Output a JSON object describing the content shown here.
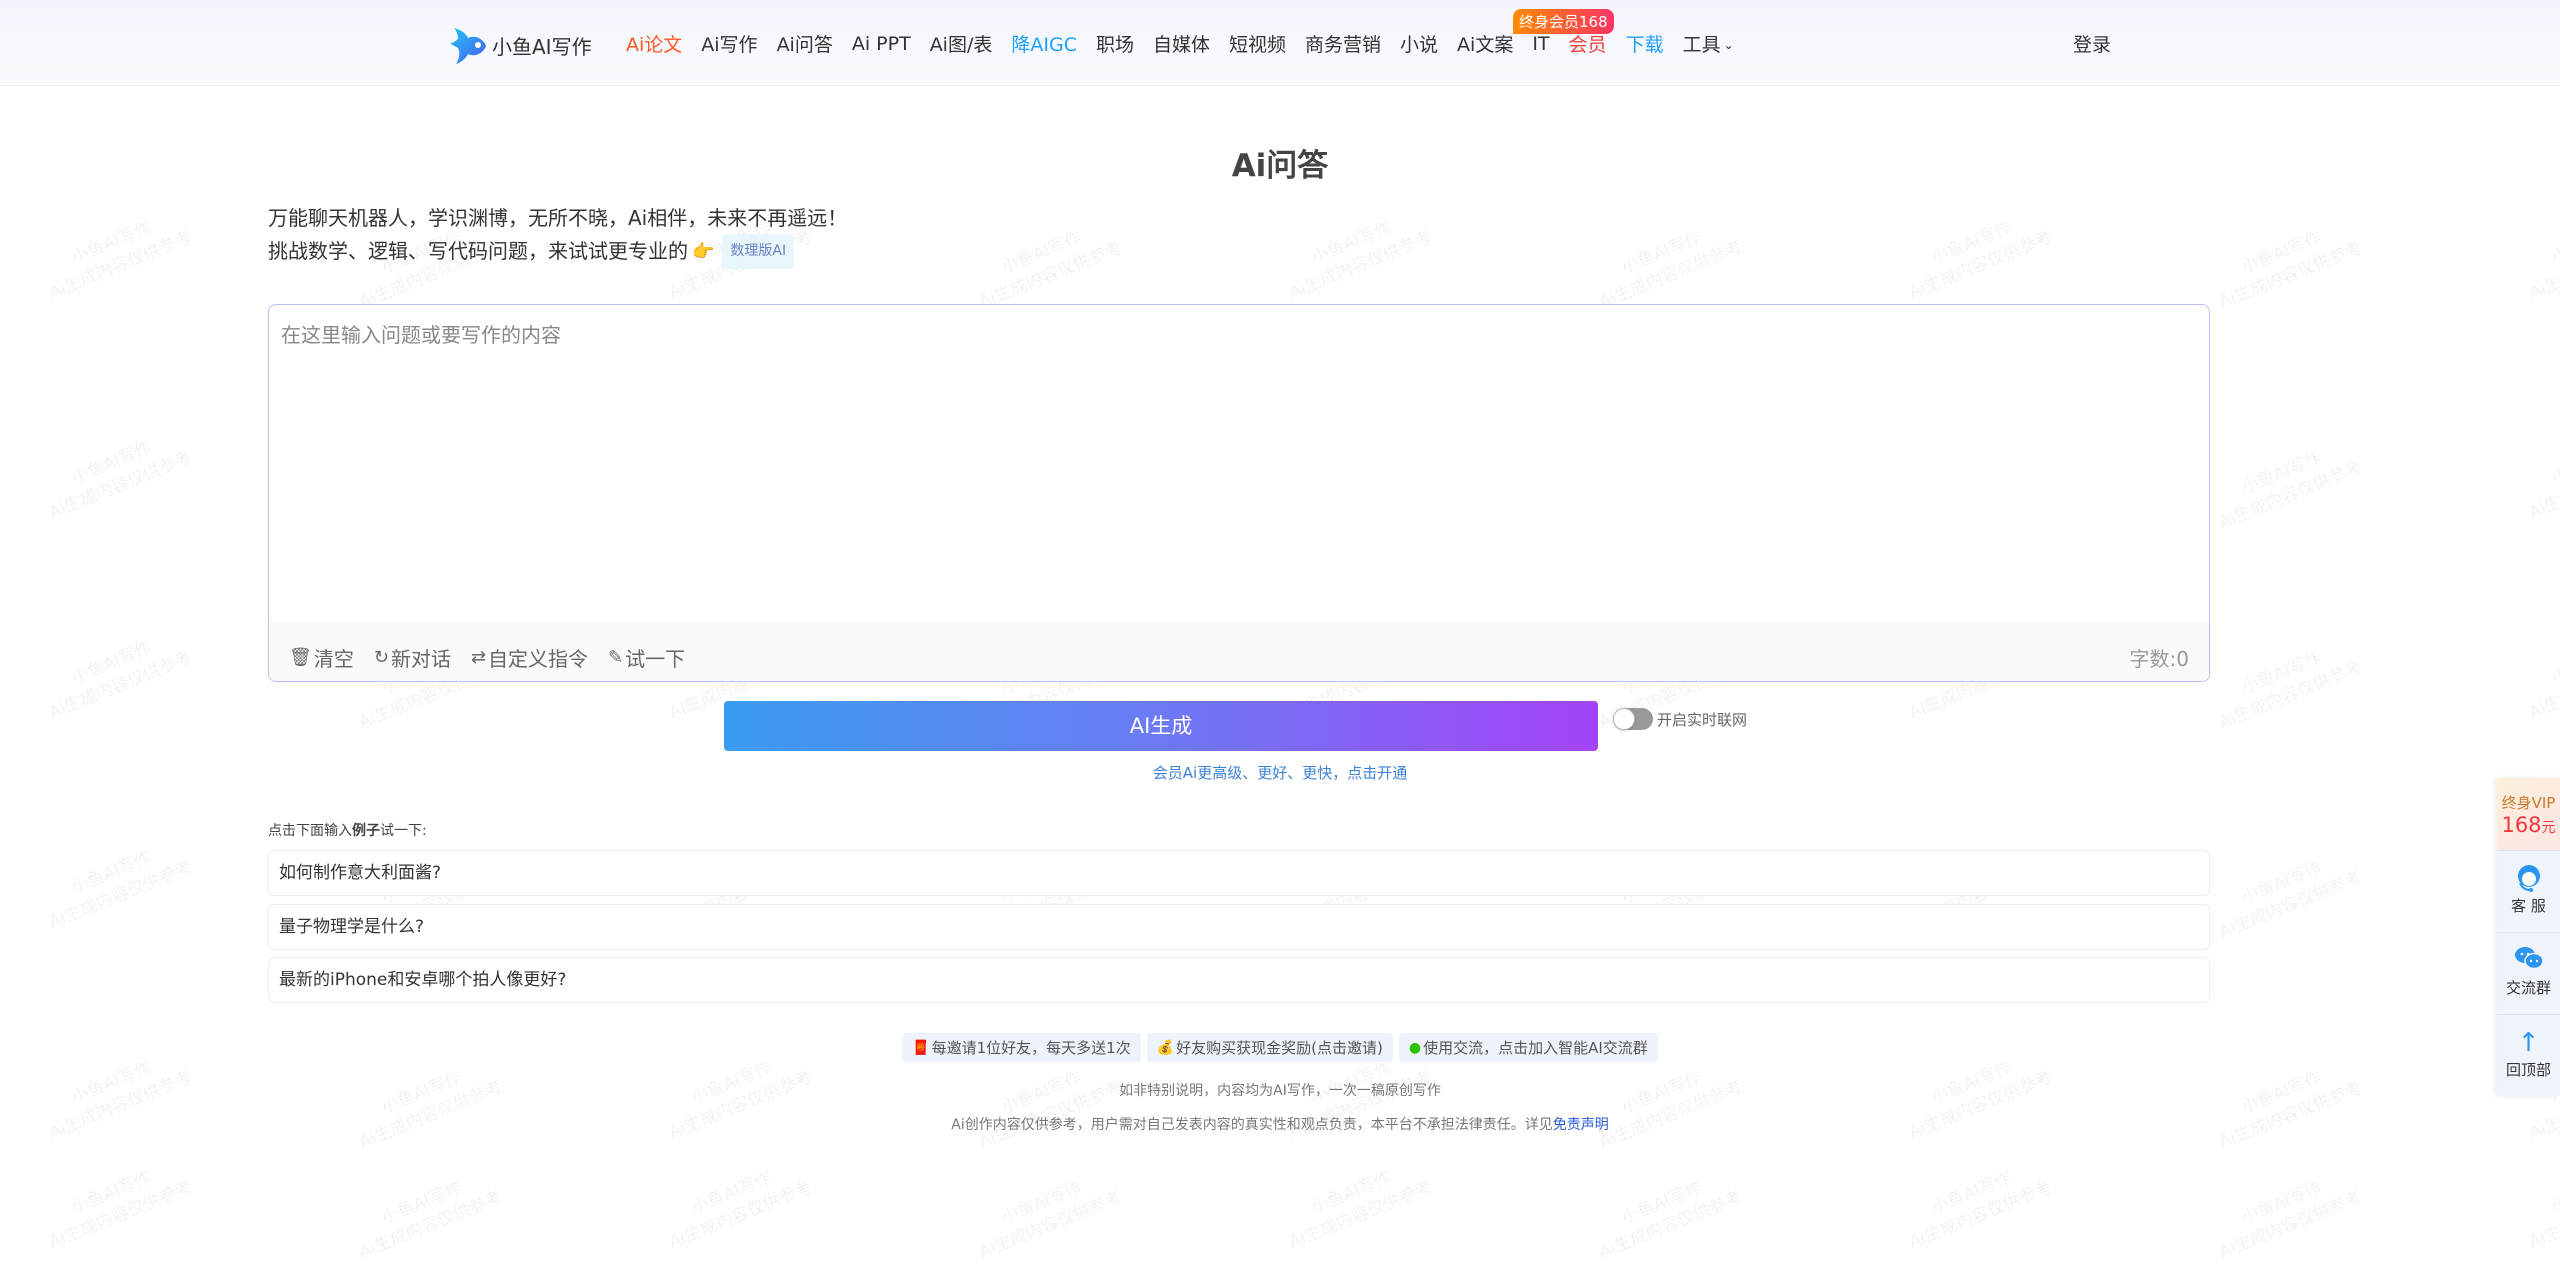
{
  "header": {
    "logo_text": "小鱼AI写作",
    "nav": [
      {
        "label": "Ai论文",
        "style": "red"
      },
      {
        "label": "Ai写作",
        "style": ""
      },
      {
        "label": "Ai问答",
        "style": ""
      },
      {
        "label": "Ai PPT",
        "style": ""
      },
      {
        "label": "Ai图/表",
        "style": ""
      },
      {
        "label": "降AIGC",
        "style": "blue"
      },
      {
        "label": "职场",
        "style": ""
      },
      {
        "label": "自媒体",
        "style": ""
      },
      {
        "label": "短视频",
        "style": ""
      },
      {
        "label": "商务营销",
        "style": ""
      },
      {
        "label": "小说",
        "style": ""
      },
      {
        "label": "Ai文案",
        "style": ""
      },
      {
        "label": "IT",
        "style": ""
      },
      {
        "label": "会员",
        "style": "vip"
      },
      {
        "label": "下载",
        "style": "blue"
      },
      {
        "label": "工具",
        "style": "dropdown"
      }
    ],
    "vip_badge": "终身会员168",
    "login_label": "登录"
  },
  "main": {
    "title": "Ai问答",
    "intro_line1": "万能聊天机器人，学识渊博，无所不晓，Ai相伴，未来不再遥远！",
    "intro_line2": "挑战数学、逻辑、写代码问题，来试试更专业的",
    "math_tag": "数理版AI",
    "editor": {
      "placeholder": "在这里输入问题或要写作的内容",
      "value": "",
      "tools": [
        {
          "icon": "trash-icon",
          "label": "清空"
        },
        {
          "icon": "refresh-icon",
          "label": "新对话"
        },
        {
          "icon": "sliders-icon",
          "label": "自定义指令"
        },
        {
          "icon": "feather-icon",
          "label": "试一下"
        }
      ],
      "word_count": "字数:0"
    },
    "generate_label": "AI生成",
    "network_toggle": {
      "label": "开启实时联网",
      "on": false
    },
    "vip_promo": "会员Ai更高级、更好、更快，点击开通",
    "examples_label_pre": "点击下面输入",
    "examples_label_bold": "例子",
    "examples_label_post": "试一下:",
    "examples": [
      "如何制作意大利面酱?",
      "量子物理学是什么?",
      "最新的iPhone和安卓哪个拍人像更好?"
    ],
    "promos": [
      {
        "icon": "red-envelope-icon",
        "label": "每邀请1位好友，每天多送1次"
      },
      {
        "icon": "money-bag-icon",
        "label": "好友购买获现金奖励(点击邀请)"
      },
      {
        "icon": "wechat-icon",
        "label": "使用交流，点击加入智能AI交流群"
      }
    ],
    "footnote1": "如非特别说明，内容均为AI写作，一次一稿原创写作",
    "footnote2": "Ai创作内容仅供参考，用户需对自己发表内容的真实性和观点负责，本平台不承担法律责任。详见",
    "disclaimer_link": "免责声明"
  },
  "side_panel": {
    "vip_line1": "终身VIP",
    "vip_price": "168",
    "vip_unit": "元",
    "items": [
      {
        "icon": "customer-service-icon",
        "label": "客 服"
      },
      {
        "icon": "wechat-group-icon",
        "label": "交流群"
      },
      {
        "icon": "arrow-up-icon",
        "label": "回顶部"
      }
    ]
  },
  "watermark": {
    "line1": "小鱼AI写作",
    "line2": "Ai生成内容仅供参考"
  },
  "colors": {
    "accent_red": "#ff5722",
    "accent_blue": "#1e9fff",
    "gradient_start": "#3a9cf0",
    "gradient_end": "#a443f7"
  }
}
